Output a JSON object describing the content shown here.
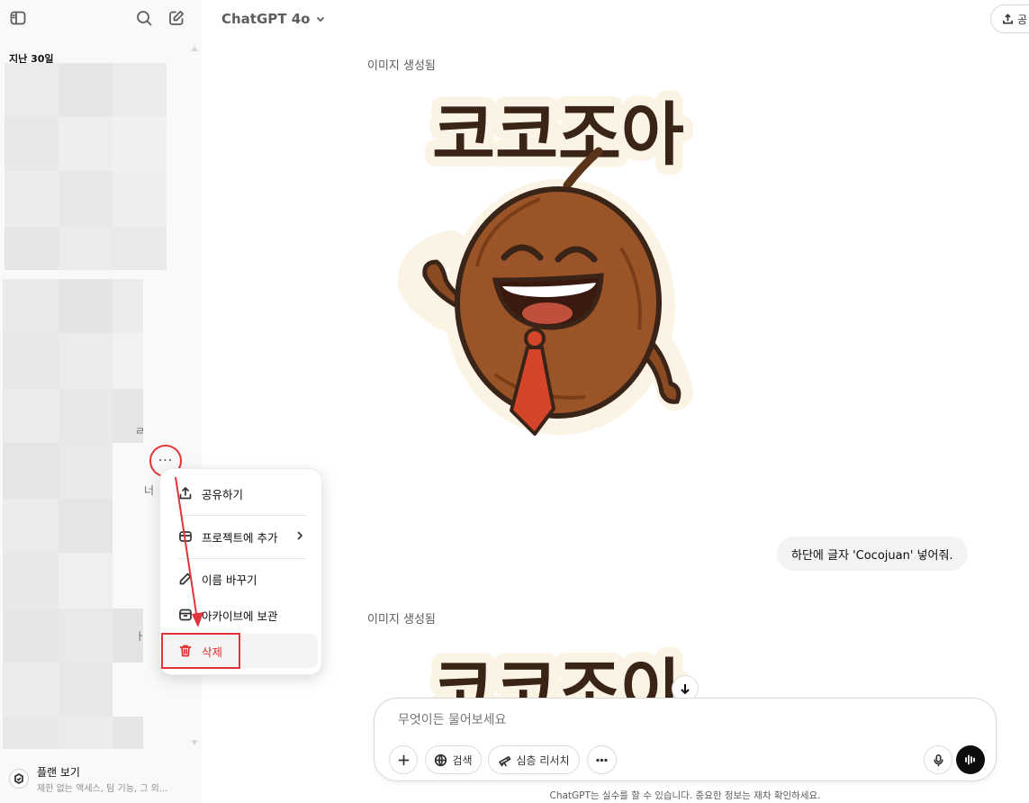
{
  "header": {
    "model_label": "ChatGPT 4o",
    "share_label": "공"
  },
  "sidebar": {
    "section_label": "지난 30일",
    "fragments": [
      "ㄹ",
      "너",
      "ㅏ"
    ],
    "more_label": "···",
    "plan": {
      "title": "플랜 보기",
      "subtitle": "제한 없는 액세스, 팀 기능, 그 외..."
    }
  },
  "chat": {
    "image_label_1": "이미지 생성됨",
    "image_label_2": "이미지 생성됨",
    "user_message": "하단에 글자 'Cocojuan' 넣어줘.",
    "sticker_text": "코코조아"
  },
  "context_menu": {
    "items": [
      {
        "label": "공유하기",
        "icon": "share-icon"
      },
      {
        "label": "프로젝트에 추가",
        "icon": "folder-icon"
      },
      {
        "label": "이름 바꾸기",
        "icon": "pencil-icon"
      },
      {
        "label": "아카이브에 보관",
        "icon": "archive-icon"
      },
      {
        "label": "삭제",
        "icon": "trash-icon"
      }
    ]
  },
  "composer": {
    "placeholder": "무엇이든 물어보세요",
    "search_label": "검색",
    "deep_research_label": "심층 리서치"
  },
  "disclaimer": "ChatGPT는 실수를 할 수 있습니다. 중요한 정보는 재차 확인하세요.",
  "colors": {
    "annotation_red": "#e0343a",
    "delete_red": "#e02e2e",
    "sidebar_bg": "#f9f9f9"
  }
}
